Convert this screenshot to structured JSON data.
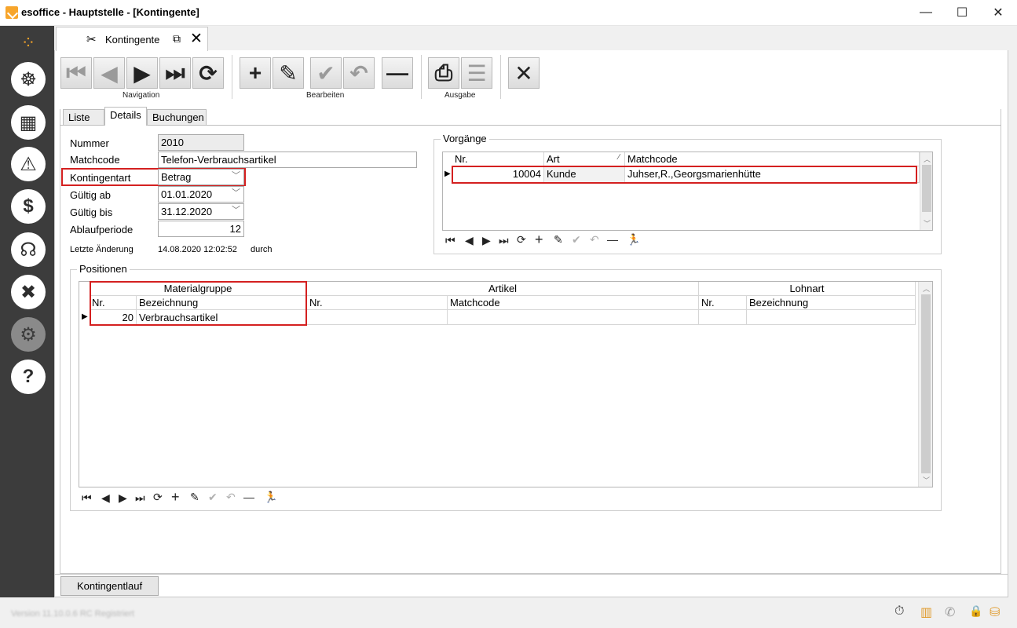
{
  "window": {
    "title": "esoffice - Hauptstelle - [Kontingente]",
    "minimize_glyph": "—",
    "maximize_glyph": "☐",
    "close_glyph": "✕"
  },
  "sidebar": {
    "logo_glyph": "⁘",
    "items": [
      {
        "icon": "helm-icon",
        "glyph": "☸"
      },
      {
        "icon": "calendar-icon",
        "glyph": "▦"
      },
      {
        "icon": "alarm-icon",
        "glyph": "⚠"
      },
      {
        "icon": "money-icon",
        "glyph": "$"
      },
      {
        "icon": "headset-icon",
        "glyph": "☊"
      },
      {
        "icon": "tools-icon",
        "glyph": "✖"
      },
      {
        "icon": "gears-icon",
        "glyph": "⚙"
      },
      {
        "icon": "help-icon",
        "glyph": "?"
      }
    ]
  },
  "doc_tab": {
    "label": "Kontingente",
    "icon_glyph": "✂",
    "popout_glyph": "⧉",
    "close_glyph": "✕"
  },
  "toolbar": {
    "groups": {
      "navigation": "Navigation",
      "edit": "Bearbeiten",
      "output": "Ausgabe"
    },
    "glyphs": {
      "first": "⏮",
      "prev": "◀",
      "next": "▶",
      "last": "⏭",
      "refresh": "⟳",
      "add": "+",
      "edit": "✎",
      "save": "✔",
      "undo": "↶",
      "delete": "—",
      "print": "⎙",
      "export": "☰",
      "close": "✕"
    }
  },
  "page_tabs": [
    "Liste",
    "Details",
    "Buchungen"
  ],
  "form": {
    "nummer_label": "Nummer",
    "nummer": "2010",
    "matchcode_label": "Matchcode",
    "matchcode": "Telefon-Verbrauchsartikel",
    "kontingentart_label": "Kontingentart",
    "kontingentart": "Betrag",
    "gueltig_ab_label": "Gültig ab",
    "gueltig_ab": "01.01.2020",
    "gueltig_bis_label": "Gültig bis",
    "gueltig_bis": "31.12.2020",
    "ablaufperiode_label": "Ablaufperiode",
    "ablaufperiode": "12",
    "letzte_aenderung_label": "Letzte Änderung",
    "letzte_aenderung": "14.08.2020 12:02:52",
    "durch_label": "durch",
    "dropdown_glyph": "﹀"
  },
  "vorgaenge": {
    "title": "Vorgänge",
    "columns": {
      "nr": "Nr.",
      "art": "Art",
      "matchcode": "Matchcode",
      "sort_glyph": "∕"
    },
    "rows": [
      {
        "nr": "10004",
        "art": "Kunde",
        "matchcode": "Juhser,R.,Georgsmarienhütte"
      }
    ]
  },
  "positionen": {
    "title": "Positionen",
    "bands": {
      "materialgruppe": "Materialgruppe",
      "artikel": "Artikel",
      "lohnart": "Lohnart"
    },
    "columns": {
      "mg_nr": "Nr.",
      "mg_bez": "Bezeichnung",
      "art_nr": "Nr.",
      "art_mc": "Matchcode",
      "lohn_nr": "Nr.",
      "lohn_bez": "Bezeichnung"
    },
    "rows": [
      {
        "mg_nr": "20",
        "mg_bez": "Verbrauchsartikel",
        "art_nr": "",
        "art_mc": "",
        "lohn_nr": "",
        "lohn_bez": ""
      }
    ]
  },
  "nav": {
    "first": "⏮",
    "prev": "◀",
    "next": "▶",
    "last": "⏭",
    "refresh": "⟳",
    "add": "+",
    "edit": "✎",
    "save": "✔",
    "undo": "↶",
    "delete": "—",
    "run": "🏃"
  },
  "bottom": {
    "run_button": "Kontingentlauf"
  },
  "status": {
    "text": "Version 11.10.0.6 RC     Registriert",
    "icons": {
      "timer": "⏱",
      "building": "▥",
      "phone": "✆",
      "lock": "🔒",
      "db": "⛁"
    }
  }
}
